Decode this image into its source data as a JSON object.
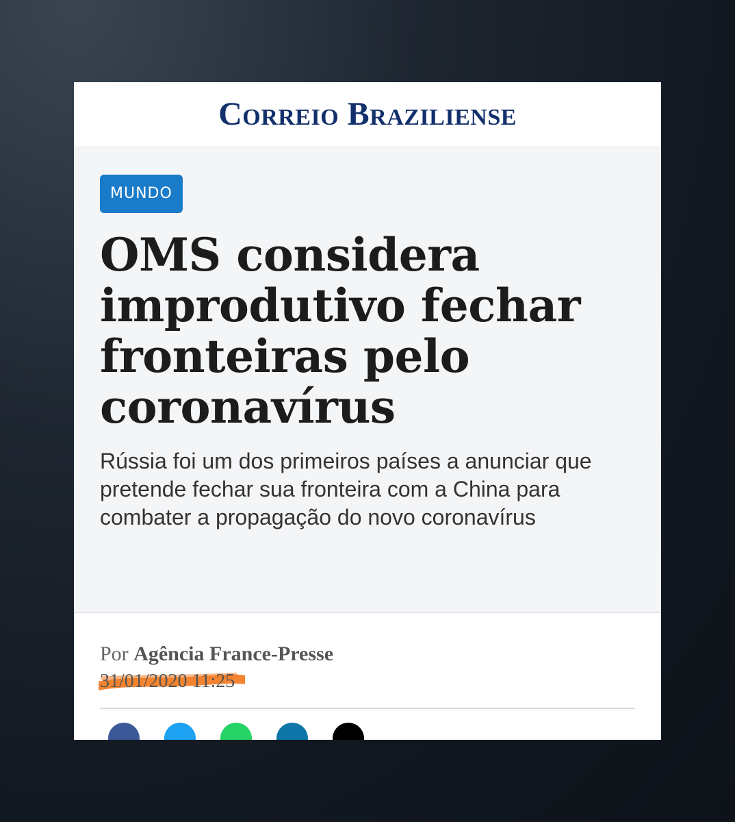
{
  "masthead": {
    "logo_text": "Correio Braziliense",
    "logo_color": "#12306b"
  },
  "article": {
    "category": "MUNDO",
    "headline": "OMS considera improdutivo fechar fronteiras pelo coronavírus",
    "subheadline": "Rússia foi um dos primeiros países a anunciar que pretende fechar sua fronteira com a China para combater a propagação do novo coronavírus",
    "byline_prefix": "Por",
    "author": "Agência France-Presse",
    "datetime": "31/01/2020 11:25"
  },
  "colors": {
    "accent": "#1a7bc9",
    "highlight": "#f47a20"
  },
  "share_buttons": [
    {
      "icon": "facebook-icon",
      "color": "#3b5998"
    },
    {
      "icon": "twitter-icon",
      "color": "#1da1f2"
    },
    {
      "icon": "whatsapp-icon",
      "color": "#25d366"
    },
    {
      "icon": "linkedin-icon",
      "color": "#0e76a8"
    },
    {
      "icon": "threads-icon",
      "color": "#000000"
    }
  ]
}
